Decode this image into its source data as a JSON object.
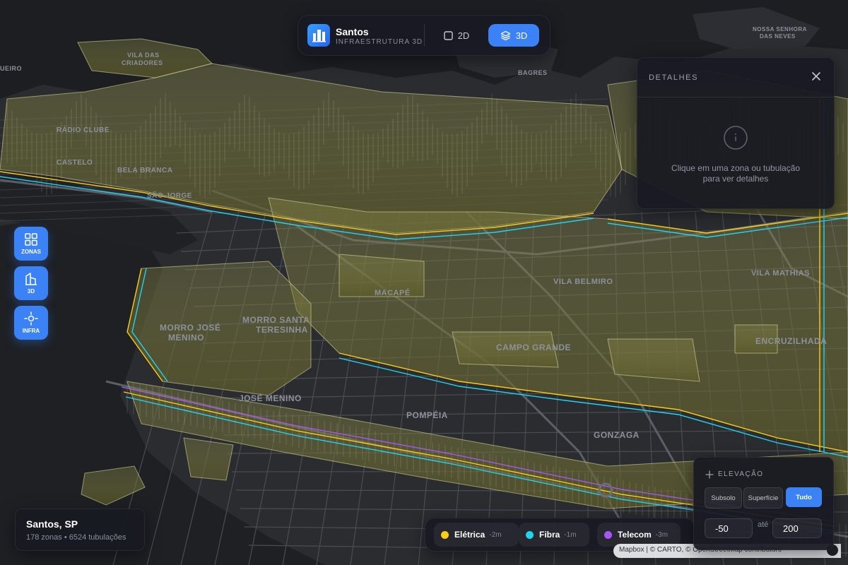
{
  "app": {
    "title": "Santos",
    "subtitle": "INFRAESTRUTURA 3D",
    "view_modes": [
      {
        "label": "2D",
        "active": false
      },
      {
        "label": "3D",
        "active": true
      }
    ]
  },
  "details": {
    "title": "DETALHES",
    "hint": "Clique em uma zona ou tubulação\npara ver detalhes"
  },
  "rail": {
    "zonas": "ZONAS",
    "three_d": "3D",
    "infra": "INFRA"
  },
  "city": {
    "name": "Santos, SP",
    "stats": "178 zonas • 6524 tubulações"
  },
  "legend": [
    {
      "name": "Elétrica",
      "depth": "-2m",
      "color": "#facc15"
    },
    {
      "name": "Fibra",
      "depth": "-1m",
      "color": "#22d3ee"
    },
    {
      "name": "Telecom",
      "depth": "-3m",
      "color": "#a855f7"
    }
  ],
  "elevation": {
    "title": "ELEVAÇÃO",
    "options": [
      "Subsolo",
      "Superfície",
      "Tudo"
    ],
    "active_option": "Tudo",
    "min": "-50",
    "between": "até",
    "max": "200"
  },
  "map_labels": {
    "nossa_senhora": "NOSSA SENHORA",
    "das_neves": "DAS NEVES",
    "bagres": "BAGRES",
    "vila_das": "VILA DAS",
    "criadores": "CRIADORES",
    "radio_clube": "RÁDIO CLUBE",
    "castelo": "CASTELO",
    "bela_branca": "BELA BRANCA",
    "sao_jorge": "SÃO JORGE",
    "macape": "MACAPÉ",
    "vila_belmiro": "VILA BELMIRO",
    "vila_mathias": "VILA MATHIAS",
    "morro_jose_menino_1": "MORRO JOSÉ",
    "morro_jose_menino_2": "MENINO",
    "morro_santa_1": "MORRO SANTA",
    "morro_santa_2": "TERESINHA",
    "campo_grande": "CAMPO GRANDE",
    "encruzilhada": "ENCRUZILHADA",
    "jose_menino": "JOSÉ MENINO",
    "pompeia": "POMPÉIA",
    "gonzaga": "GONZAGA",
    "ueiro": "UEIRO"
  },
  "attribution": "Mapbox | © CARTO, © OpenStreetMap contributors",
  "colors": {
    "accent": "#3b82f6",
    "zone_fill": "#7a7a3c",
    "zone_edge": "#e8e4a0",
    "water": "#1c1e22",
    "land": "#2a2c30"
  }
}
